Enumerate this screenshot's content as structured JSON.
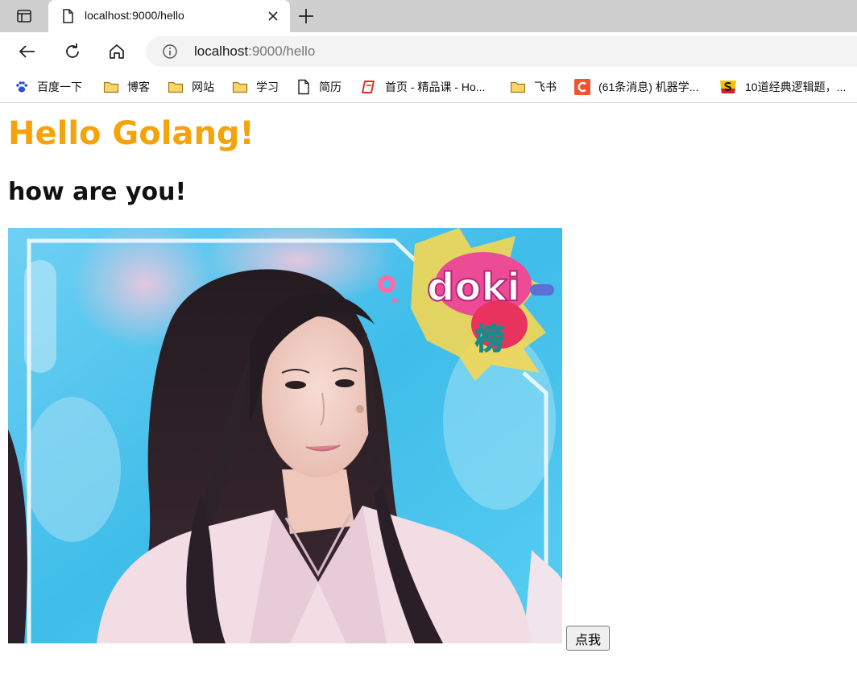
{
  "browser": {
    "tab": {
      "title": "localhost:9000/hello"
    },
    "url": {
      "host": "localhost",
      "path": ":9000/hello"
    }
  },
  "bookmarks": [
    {
      "label": "百度一下",
      "icon": "paw-icon"
    },
    {
      "label": "博客",
      "icon": "folder-icon"
    },
    {
      "label": "网站",
      "icon": "folder-icon"
    },
    {
      "label": "学习",
      "icon": "folder-icon"
    },
    {
      "label": "简历",
      "icon": "document-icon"
    },
    {
      "label": "首页 - 精品课 - Ho...",
      "icon": "red-logo-icon"
    },
    {
      "label": "飞书",
      "icon": "folder-icon"
    },
    {
      "label": "(61条消息) 机器学...",
      "icon": "csdn-c-icon"
    },
    {
      "label": "10道经典逻辑题，...",
      "icon": "s-logo-icon"
    }
  ],
  "page": {
    "heading": "Hello Golang!",
    "subheading": "how are you!",
    "button_label": "点我"
  },
  "image_overlay": {
    "logo_text": "doki",
    "logo_subtext": "榜"
  },
  "colors": {
    "heading": "#f5a30b",
    "tabstrip": "#cfcfcf",
    "omnibox": "#f3f3f3"
  }
}
